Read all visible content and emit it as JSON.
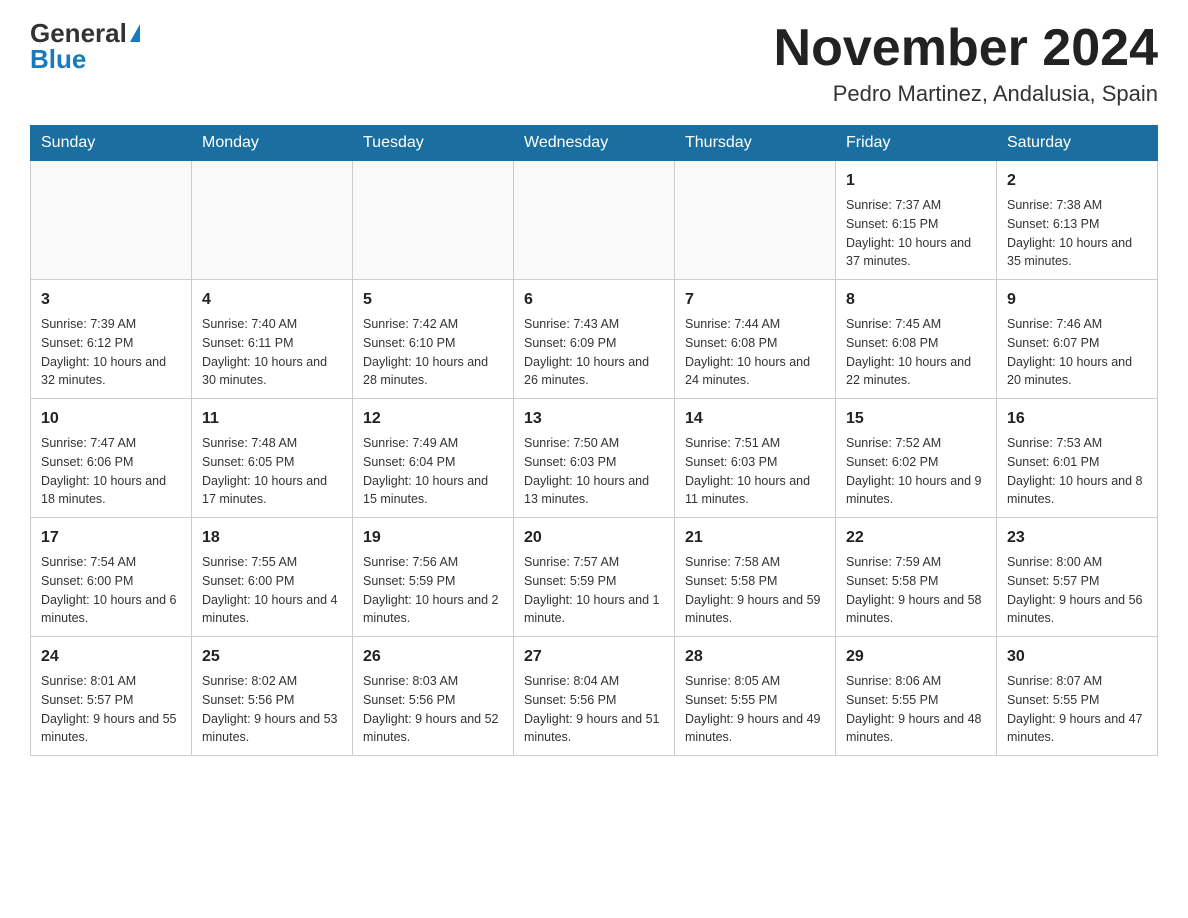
{
  "header": {
    "logo_general": "General",
    "logo_blue": "Blue",
    "month_title": "November 2024",
    "location": "Pedro Martinez, Andalusia, Spain"
  },
  "calendar": {
    "days_of_week": [
      "Sunday",
      "Monday",
      "Tuesday",
      "Wednesday",
      "Thursday",
      "Friday",
      "Saturday"
    ],
    "weeks": [
      [
        {
          "day": "",
          "info": ""
        },
        {
          "day": "",
          "info": ""
        },
        {
          "day": "",
          "info": ""
        },
        {
          "day": "",
          "info": ""
        },
        {
          "day": "",
          "info": ""
        },
        {
          "day": "1",
          "info": "Sunrise: 7:37 AM\nSunset: 6:15 PM\nDaylight: 10 hours and 37 minutes."
        },
        {
          "day": "2",
          "info": "Sunrise: 7:38 AM\nSunset: 6:13 PM\nDaylight: 10 hours and 35 minutes."
        }
      ],
      [
        {
          "day": "3",
          "info": "Sunrise: 7:39 AM\nSunset: 6:12 PM\nDaylight: 10 hours and 32 minutes."
        },
        {
          "day": "4",
          "info": "Sunrise: 7:40 AM\nSunset: 6:11 PM\nDaylight: 10 hours and 30 minutes."
        },
        {
          "day": "5",
          "info": "Sunrise: 7:42 AM\nSunset: 6:10 PM\nDaylight: 10 hours and 28 minutes."
        },
        {
          "day": "6",
          "info": "Sunrise: 7:43 AM\nSunset: 6:09 PM\nDaylight: 10 hours and 26 minutes."
        },
        {
          "day": "7",
          "info": "Sunrise: 7:44 AM\nSunset: 6:08 PM\nDaylight: 10 hours and 24 minutes."
        },
        {
          "day": "8",
          "info": "Sunrise: 7:45 AM\nSunset: 6:08 PM\nDaylight: 10 hours and 22 minutes."
        },
        {
          "day": "9",
          "info": "Sunrise: 7:46 AM\nSunset: 6:07 PM\nDaylight: 10 hours and 20 minutes."
        }
      ],
      [
        {
          "day": "10",
          "info": "Sunrise: 7:47 AM\nSunset: 6:06 PM\nDaylight: 10 hours and 18 minutes."
        },
        {
          "day": "11",
          "info": "Sunrise: 7:48 AM\nSunset: 6:05 PM\nDaylight: 10 hours and 17 minutes."
        },
        {
          "day": "12",
          "info": "Sunrise: 7:49 AM\nSunset: 6:04 PM\nDaylight: 10 hours and 15 minutes."
        },
        {
          "day": "13",
          "info": "Sunrise: 7:50 AM\nSunset: 6:03 PM\nDaylight: 10 hours and 13 minutes."
        },
        {
          "day": "14",
          "info": "Sunrise: 7:51 AM\nSunset: 6:03 PM\nDaylight: 10 hours and 11 minutes."
        },
        {
          "day": "15",
          "info": "Sunrise: 7:52 AM\nSunset: 6:02 PM\nDaylight: 10 hours and 9 minutes."
        },
        {
          "day": "16",
          "info": "Sunrise: 7:53 AM\nSunset: 6:01 PM\nDaylight: 10 hours and 8 minutes."
        }
      ],
      [
        {
          "day": "17",
          "info": "Sunrise: 7:54 AM\nSunset: 6:00 PM\nDaylight: 10 hours and 6 minutes."
        },
        {
          "day": "18",
          "info": "Sunrise: 7:55 AM\nSunset: 6:00 PM\nDaylight: 10 hours and 4 minutes."
        },
        {
          "day": "19",
          "info": "Sunrise: 7:56 AM\nSunset: 5:59 PM\nDaylight: 10 hours and 2 minutes."
        },
        {
          "day": "20",
          "info": "Sunrise: 7:57 AM\nSunset: 5:59 PM\nDaylight: 10 hours and 1 minute."
        },
        {
          "day": "21",
          "info": "Sunrise: 7:58 AM\nSunset: 5:58 PM\nDaylight: 9 hours and 59 minutes."
        },
        {
          "day": "22",
          "info": "Sunrise: 7:59 AM\nSunset: 5:58 PM\nDaylight: 9 hours and 58 minutes."
        },
        {
          "day": "23",
          "info": "Sunrise: 8:00 AM\nSunset: 5:57 PM\nDaylight: 9 hours and 56 minutes."
        }
      ],
      [
        {
          "day": "24",
          "info": "Sunrise: 8:01 AM\nSunset: 5:57 PM\nDaylight: 9 hours and 55 minutes."
        },
        {
          "day": "25",
          "info": "Sunrise: 8:02 AM\nSunset: 5:56 PM\nDaylight: 9 hours and 53 minutes."
        },
        {
          "day": "26",
          "info": "Sunrise: 8:03 AM\nSunset: 5:56 PM\nDaylight: 9 hours and 52 minutes."
        },
        {
          "day": "27",
          "info": "Sunrise: 8:04 AM\nSunset: 5:56 PM\nDaylight: 9 hours and 51 minutes."
        },
        {
          "day": "28",
          "info": "Sunrise: 8:05 AM\nSunset: 5:55 PM\nDaylight: 9 hours and 49 minutes."
        },
        {
          "day": "29",
          "info": "Sunrise: 8:06 AM\nSunset: 5:55 PM\nDaylight: 9 hours and 48 minutes."
        },
        {
          "day": "30",
          "info": "Sunrise: 8:07 AM\nSunset: 5:55 PM\nDaylight: 9 hours and 47 minutes."
        }
      ]
    ]
  }
}
